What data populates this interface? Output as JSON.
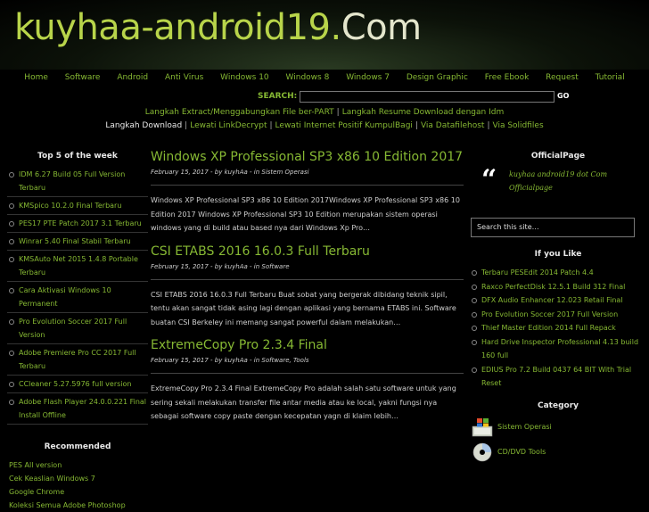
{
  "header": {
    "logo_part1": "kuyhaa-android19.",
    "logo_part2": "Com"
  },
  "nav": [
    "Home",
    "Software",
    "Android",
    "Anti Virus",
    "Windows 10",
    "Windows 8",
    "Windows 7",
    "Design Graphic",
    "Free Ebook",
    "Request",
    "Tutorial"
  ],
  "search": {
    "label": "SEARCH:",
    "value": "",
    "go_label": "GO"
  },
  "links_row1": [
    "Langkah Extract/Menggabungkan File ber-PART",
    "Langkah Resume Download dengan Idm"
  ],
  "links_row2_label": "Langkah Download",
  "links_row2": [
    "Lewati LinkDecrypt",
    "Lewati Internet Positif KumpulBagi",
    "Via Datafilehost",
    "Via Solidfiles"
  ],
  "left": {
    "top5_title": "Top 5 of the week",
    "top5": [
      "IDM 6.27 Build 05 Full Version Terbaru",
      "KMSpico 10.2.0 Final Terbaru",
      "PES17 PTE Patch 2017 3.1 Terbaru",
      "Winrar 5.40 Final Stabil Terbaru",
      "KMSAuto Net 2015 1.4.8 Portable Terbaru",
      "Cara Aktivasi Windows 10 Permanent",
      "Pro Evolution Soccer 2017 Full Version",
      "Adobe Premiere Pro CC 2017 Full Terbaru",
      "CCleaner 5.27.5976 full version",
      "Adobe Flash Player 24.0.0.221 Final Install Offline"
    ],
    "recommended_title": "Recommended",
    "recommended": [
      "PES All version",
      "Cek Keaslian Windows 7",
      "Google Chrome",
      "Koleksi Semua Adobe Photoshop"
    ]
  },
  "posts": [
    {
      "title": "Windows XP Professional SP3 x86 10 Edition 2017",
      "date": "February 15, 2017",
      "author": "kuyhAa",
      "category": "Sistem Operasi",
      "excerpt": "Windows XP Professional SP3 x86 10 Edition 2017Windows XP Professional SP3 x86 10 Edition 2017 Windows XP Professional SP3 10 Edition merupakan sistem operasi windows yang di build atau based nya dari Windows Xp Pro…"
    },
    {
      "title": "CSI ETABS 2016 16.0.3 Full Terbaru",
      "date": "February 15, 2017",
      "author": "kuyhAa",
      "category": "Software",
      "excerpt": "CSI ETABS 2016 16.0.3 Full Terbaru Buat sobat yang bergerak dibidang teknik sipil, tentu akan sangat tidak asing lagi dengan aplikasi yang bernama ETABS ini. Software buatan CSI Berkeley ini memang sangat powerful dalam melakukan…"
    },
    {
      "title": "ExtremeCopy Pro 2.3.4 Final",
      "date": "February 15, 2017",
      "author": "kuyhAa",
      "category": "Software, Tools",
      "excerpt": "ExtremeCopy Pro 2.3.4 Final ExtremeCopy Pro adalah salah satu software untuk yang sering sekali melakukan transfer file antar media atau ke local, yakni fungsi nya sebagai software copy paste dengan kecepatan yagn di klaim lebih…"
    }
  ],
  "meta_by": "by",
  "meta_in": "in",
  "right": {
    "official_title": "OfficialPage",
    "official_text": "kuyhaa android19 dot Com Officialpage",
    "search_placeholder": "Search this site…",
    "you_like_title": "If you Like",
    "you_like": [
      "Terbaru PESEdit 2014 Patch 4.4",
      "Raxco PerfectDisk 12.5.1 Build 312 Final",
      "DFX Audio Enhancer 12.023 Retail Final",
      "Pro Evolution Soccer 2017 Full Version",
      "Thief Master Edition 2014 Full Repack",
      "Hard Drive Inspector Professional 4.13 build 160 full",
      "EDIUS Pro 7.2 Build 0437 64 BIT With Trial Reset"
    ],
    "category_title": "Category",
    "categories": [
      "Sistem Operasi",
      "CD/DVD Tools"
    ]
  },
  "colors": {
    "accent": "#86b833",
    "background": "#000000",
    "text": "#cfcfcf"
  }
}
